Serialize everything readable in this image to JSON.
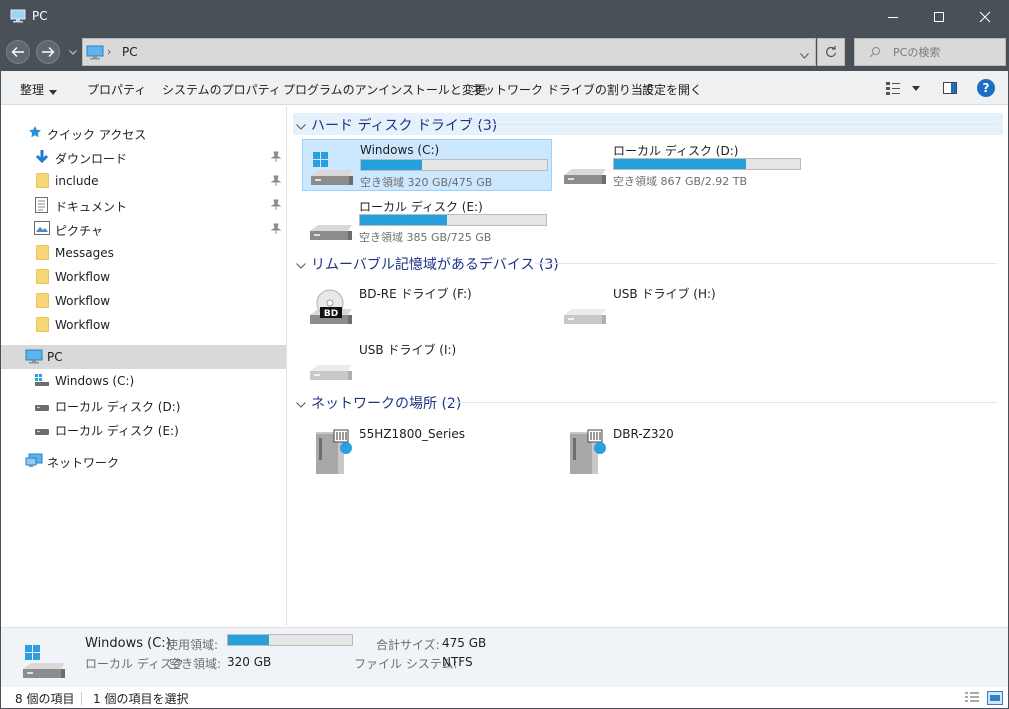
{
  "window": {
    "title": "PC",
    "minimize_label": "",
    "maximize_label": "",
    "close_label": ""
  },
  "address": {
    "crumb": "PC",
    "search_placeholder": "PCの検索"
  },
  "commands": {
    "organize": "整理",
    "properties": "プロパティ",
    "system_properties": "システムのプロパティ",
    "uninstall": "プログラムのアンインストールと変更",
    "map_drive": "ネットワーク ドライブの割り当て",
    "open_settings": "設定を開く",
    "help": "?"
  },
  "nav": {
    "quick_access": "クイック アクセス",
    "quick_items": [
      {
        "label": "ダウンロード",
        "icon": "download-arrow-icon",
        "pinned": true
      },
      {
        "label": "include",
        "icon": "folder-icon",
        "pinned": true
      },
      {
        "label": "ドキュメント",
        "icon": "document-icon",
        "pinned": true
      },
      {
        "label": "ピクチャ",
        "icon": "picture-icon",
        "pinned": true
      },
      {
        "label": "Messages",
        "icon": "folder-icon",
        "pinned": false
      },
      {
        "label": "Workflow",
        "icon": "folder-icon",
        "pinned": false
      },
      {
        "label": "Workflow",
        "icon": "folder-icon",
        "pinned": false
      },
      {
        "label": "Workflow",
        "icon": "folder-icon",
        "pinned": false
      }
    ],
    "pc": "PC",
    "pc_items": [
      {
        "label": "Windows (C:)",
        "icon": "windows-drive-icon"
      },
      {
        "label": "ローカル ディスク (D:)",
        "icon": "drive-icon"
      },
      {
        "label": "ローカル ディスク (E:)",
        "icon": "drive-icon"
      }
    ],
    "network": "ネットワーク"
  },
  "groups": {
    "hdd": "ハード ディスク ドライブ (3)",
    "removable": "リムーバブル記憶域があるデバイス (3)",
    "network": "ネットワークの場所 (2)"
  },
  "drives": [
    {
      "name": "Windows (C:)",
      "free": "空き領域 320 GB/475 GB",
      "used_fraction": 0.33
    },
    {
      "name": "ローカル ディスク (D:)",
      "free": "空き領域 867 GB/2.92 TB",
      "used_fraction": 0.71
    },
    {
      "name": "ローカル ディスク (E:)",
      "free": "空き領域 385 GB/725 GB",
      "used_fraction": 0.47
    }
  ],
  "removable": [
    {
      "name": "BD-RE ドライブ (F:)",
      "icon": "bluray-drive-icon",
      "badge": "BD"
    },
    {
      "name": "USB ドライブ (H:)",
      "icon": "usb-drive-icon"
    },
    {
      "name": "USB ドライブ (I:)",
      "icon": "usb-drive-icon"
    }
  ],
  "network_locations": [
    {
      "name": "55HZ1800_Series",
      "icon": "media-server-icon"
    },
    {
      "name": "DBR-Z320",
      "icon": "media-server-icon"
    }
  ],
  "details": {
    "name": "Windows (C:)",
    "type": "ローカル ディスク",
    "used_key": "使用領域:",
    "used_fraction": 0.33,
    "free_key": "空き領域:",
    "free_value": "320 GB",
    "total_key": "合計サイズ:",
    "total_value": "475 GB",
    "fs_key": "ファイル システム:",
    "fs_value": "NTFS"
  },
  "status": {
    "count": "8 個の項目",
    "selected": "1 個の項目を選択"
  },
  "colors": {
    "titlebar": "#4a5058",
    "accent": "#26a0da",
    "group_header": "#1e3287",
    "selection": "#cce8ff"
  }
}
